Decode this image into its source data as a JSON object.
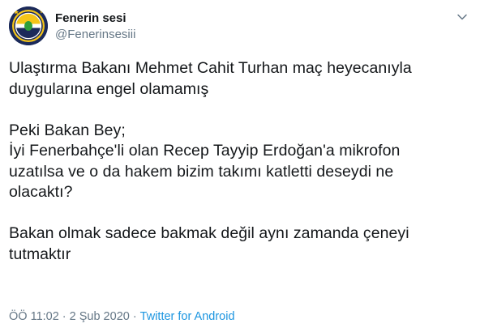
{
  "user": {
    "display_name": "Fenerin sesi",
    "handle": "@Fenerinsesiii",
    "avatar_icon": "fenerbahce-crest-icon"
  },
  "menu": {
    "icon": "chevron-down-icon"
  },
  "tweet": {
    "paragraphs": [
      [
        "Ulaştırma Bakanı Mehmet Cahit Turhan maç heyecanıyla",
        "duygularına engel olamamış"
      ],
      [
        "Peki Bakan Bey;",
        "İyi Fenerbahçe'li olan Recep Tayyip Erdoğan'a mikrofon",
        "uzatılsa ve o da hakem bizim takımı katletti deseydi ne",
        "olacaktı?"
      ],
      [
        "Bakan olmak sadece bakmak değil aynı zamanda çeneyi",
        "tutmaktır"
      ]
    ]
  },
  "meta": {
    "time": "ÖÖ 11:02",
    "separator": "·",
    "date": "2 Şub 2020",
    "source": "Twitter for Android"
  },
  "colors": {
    "text": "#14171a",
    "secondary": "#657786",
    "link": "#1b95e0",
    "crest_navy": "#1b2a5a",
    "crest_yellow": "#f5c518"
  }
}
